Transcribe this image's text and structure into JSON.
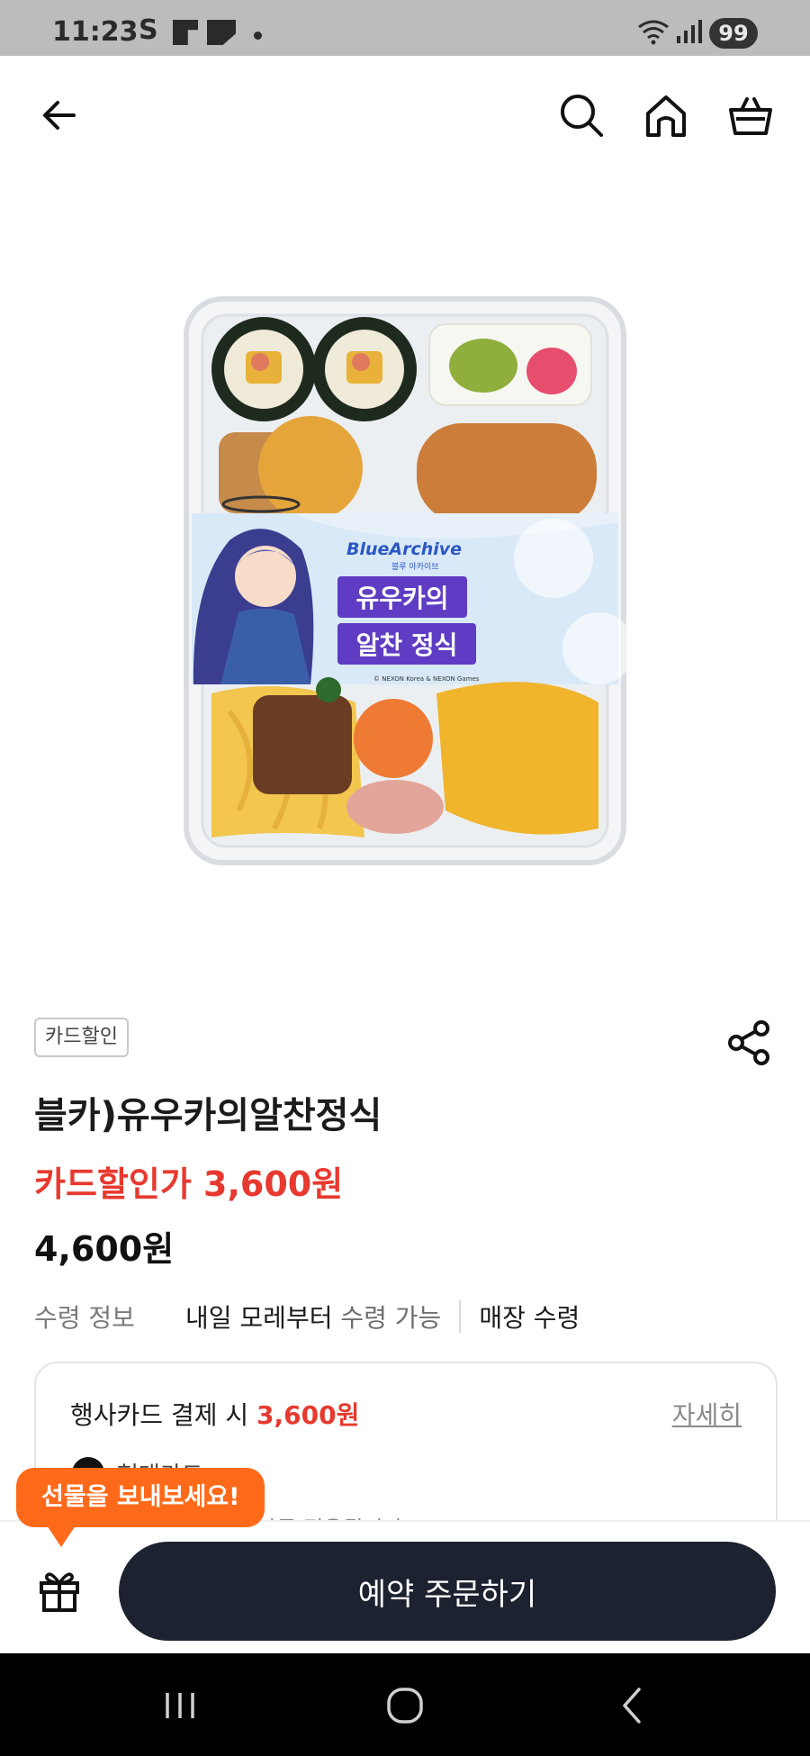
{
  "status_bar": {
    "time": "11:23",
    "carrier_mark": "S",
    "battery": "99"
  },
  "nav": {
    "back": "back",
    "search": "search",
    "home": "home",
    "cart": "cart"
  },
  "product": {
    "badge": "카드할인",
    "name": "블카)유우카의알찬정식",
    "card_price": "카드할인가 3,600원",
    "price": "4,600원",
    "pickup_label": "수령 정보",
    "pickup_date": "내일 모레부터",
    "pickup_status": "수령 가능",
    "pickup_type": "매장 수령"
  },
  "photo": {
    "brand": "BlueArchive",
    "brand_sub": "블루 아카이브",
    "label_line1": "유우카의",
    "label_line2": "알찬 정식",
    "copyright": "© NEXON Korea & NEXON Games"
  },
  "benefit": {
    "prefix": "행사카드 결제 시",
    "amount": "3,600원",
    "more": "자세히",
    "card_name": "현대카드",
    "card_note": "결제 시 세액이 자동 적용됩니다"
  },
  "gift_tooltip": "선물을 보내보세요!",
  "order_button": "예약 주문하기",
  "colors": {
    "accent_red": "#e7392f",
    "tooltip_orange": "#ff6a1a",
    "button_navy": "#1d2231"
  }
}
